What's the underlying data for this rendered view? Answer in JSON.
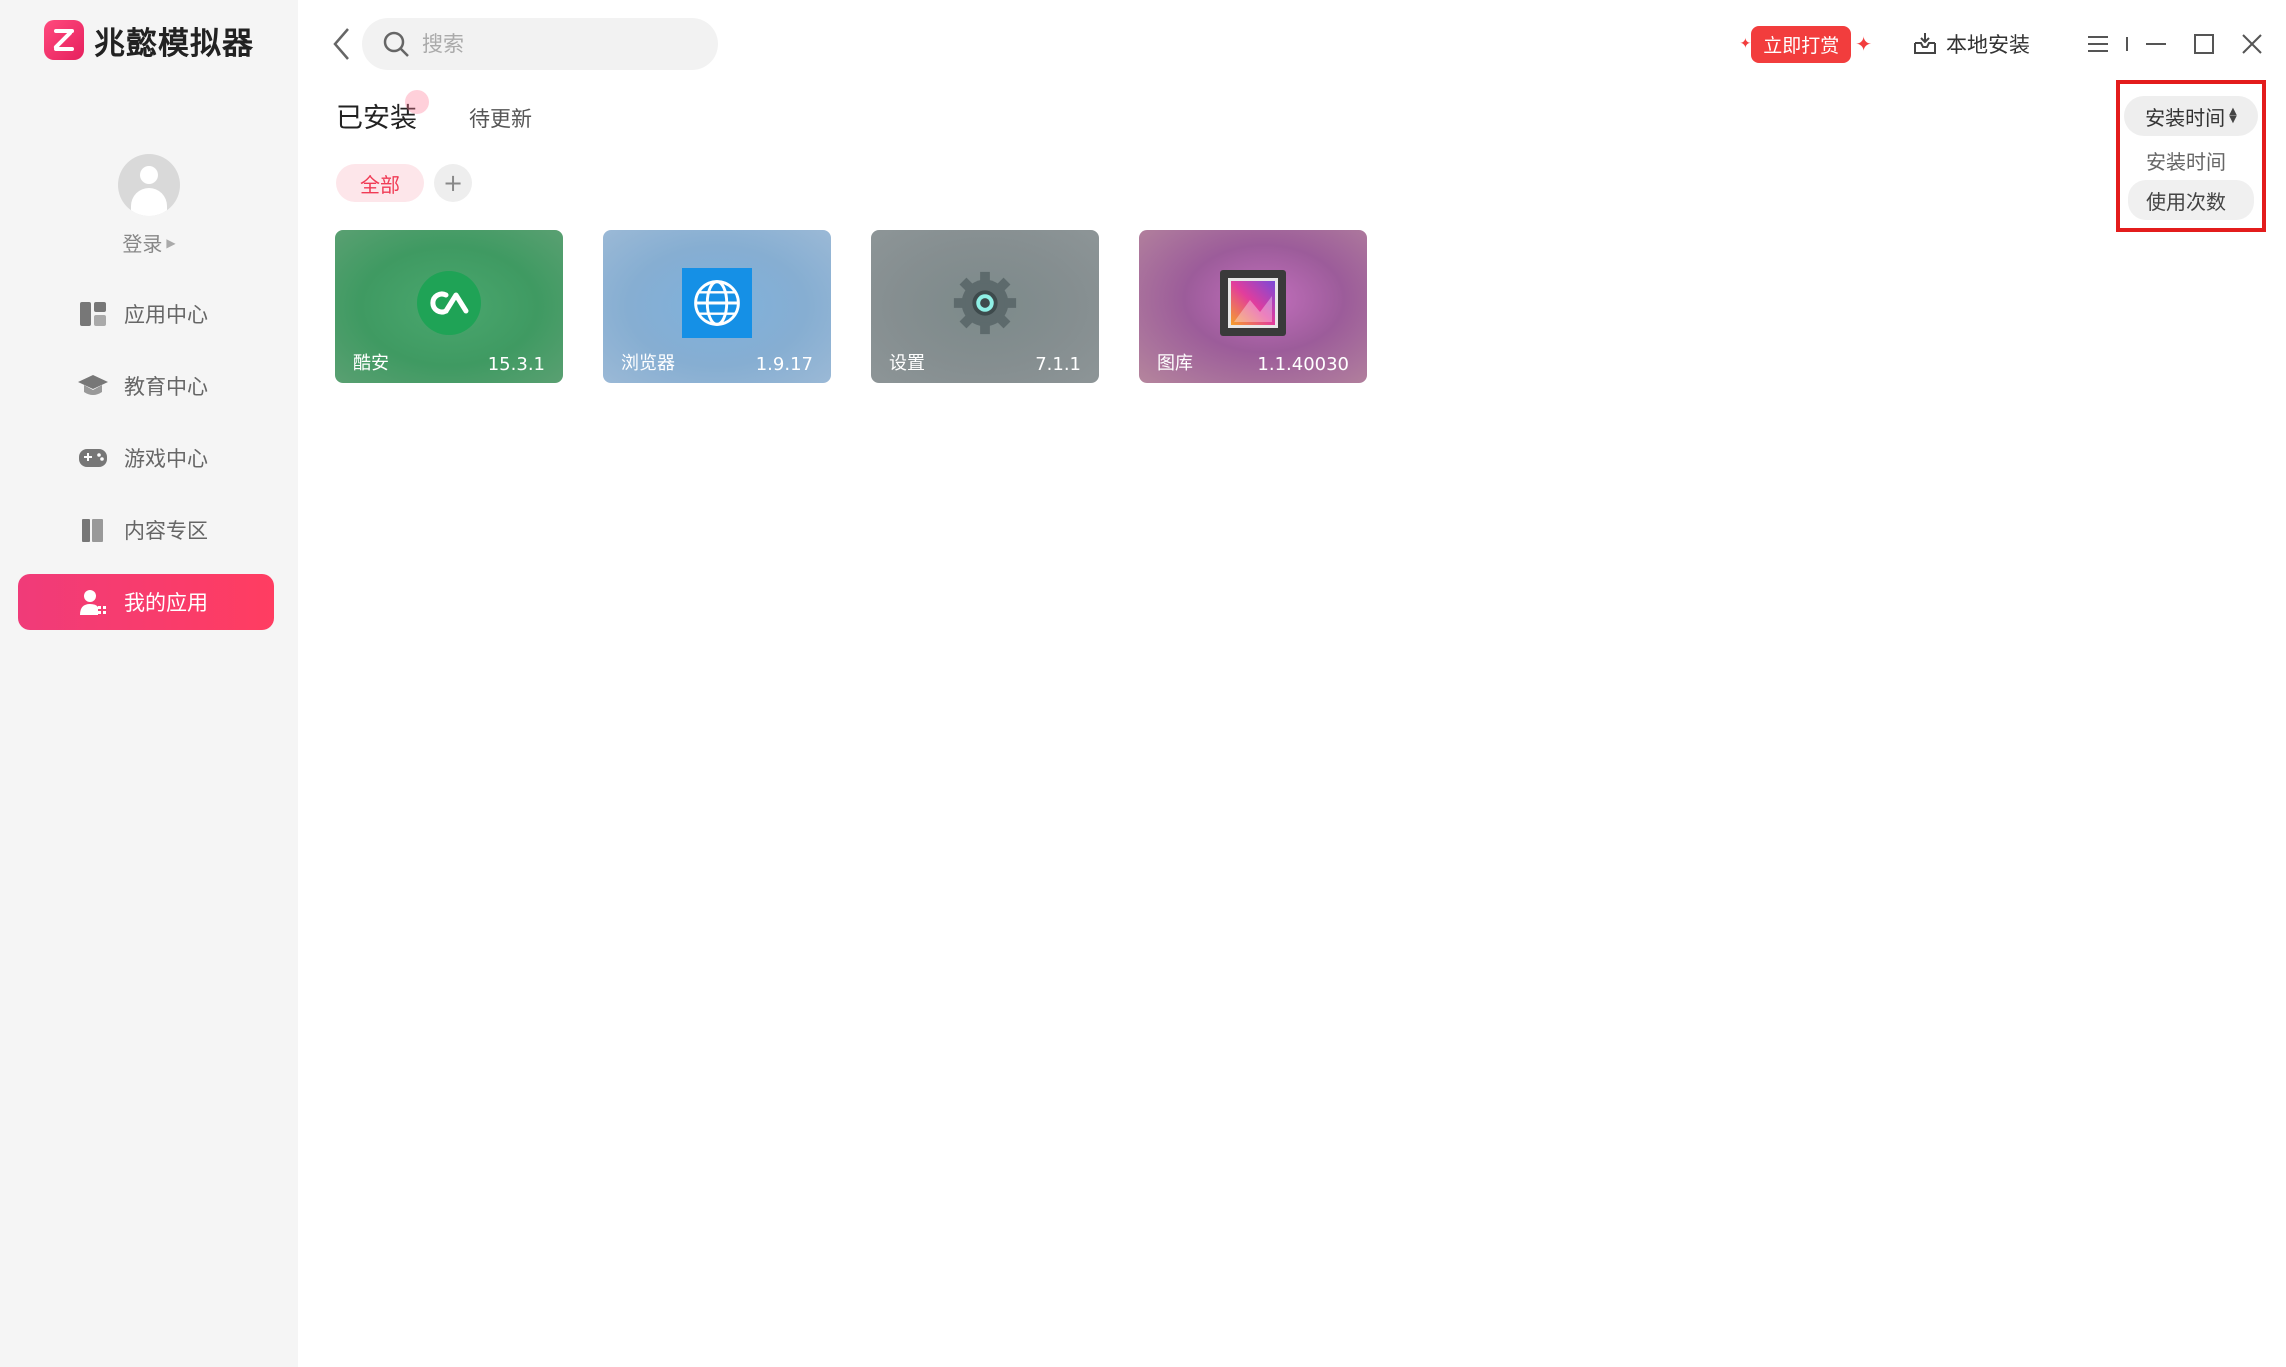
{
  "app": {
    "name": "兆懿模拟器"
  },
  "user": {
    "login_label": "登录"
  },
  "sidebar": {
    "items": [
      {
        "label": "应用中心",
        "icon": "app-center-icon"
      },
      {
        "label": "教育中心",
        "icon": "graduation-cap-icon"
      },
      {
        "label": "游戏中心",
        "icon": "gamepad-icon"
      },
      {
        "label": "内容专区",
        "icon": "books-icon"
      },
      {
        "label": "我的应用",
        "icon": "user-apps-icon",
        "active": true
      }
    ]
  },
  "search": {
    "placeholder": "搜索",
    "value": ""
  },
  "header": {
    "reward_label": "立即打赏",
    "local_install_label": "本地安装"
  },
  "tabs": [
    {
      "label": "已安装",
      "active": true
    },
    {
      "label": "待更新",
      "active": false
    }
  ],
  "filters": {
    "all_label": "全部",
    "add_label": "+"
  },
  "apps": [
    {
      "name": "酷安",
      "version": "15.3.1",
      "icon": "coolapk-icon"
    },
    {
      "name": "浏览器",
      "version": "1.9.17",
      "icon": "globe-icon"
    },
    {
      "name": "设置",
      "version": "7.1.1",
      "icon": "gear-icon"
    },
    {
      "name": "图库",
      "version": "1.1.40030",
      "icon": "gallery-icon"
    }
  ],
  "sort": {
    "current": "安装时间",
    "options": [
      "安装时间",
      "使用次数"
    ],
    "hovered": "使用次数"
  },
  "colors": {
    "accent": "#f03b79",
    "highlight": "#e31c1c"
  }
}
